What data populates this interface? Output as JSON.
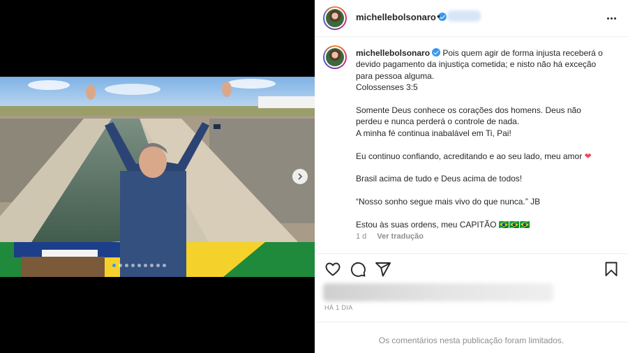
{
  "post": {
    "username": "michellebolsonaro",
    "dot": "•",
    "menu_icon": "more-horizontal-icon",
    "caption_lines": [
      "Pois quem agir de forma injusta receberá o",
      "devido pagamento da injustiça cometida; e nisto não há exceção",
      "para pessoa alguma.",
      "Colossenses 3:5",
      "",
      "Somente Deus conhece os corações dos homens. Deus não",
      "perdeu e nunca perderá o controle de nada.",
      "A minha fé continua inabalável em Ti, Pai!",
      "",
      "Eu continuo confiando, acreditando e ao seu lado, meu amor",
      "",
      "Brasil acima de tudo e Deus acima de todos!",
      "",
      "“Nosso sonho segue mais vivo do que nunca.” JB",
      "",
      "Estou às suas ordens, meu CAPITÃO 🇧🇷🇧🇷🇧🇷"
    ],
    "heart_emoji": "❤",
    "caption_age": "1 d",
    "translate_label": "Ver tradução",
    "time_ago": "HÁ 1 DIA",
    "comments_limited": "Os comentários nesta publicação foram limitados.",
    "carousel": {
      "count": 9,
      "active_index": 0
    }
  },
  "colors": {
    "accent": "#3897f0",
    "heart": "#ed4956",
    "secondary_text": "#8e8e8e",
    "primary_text": "#262626"
  }
}
